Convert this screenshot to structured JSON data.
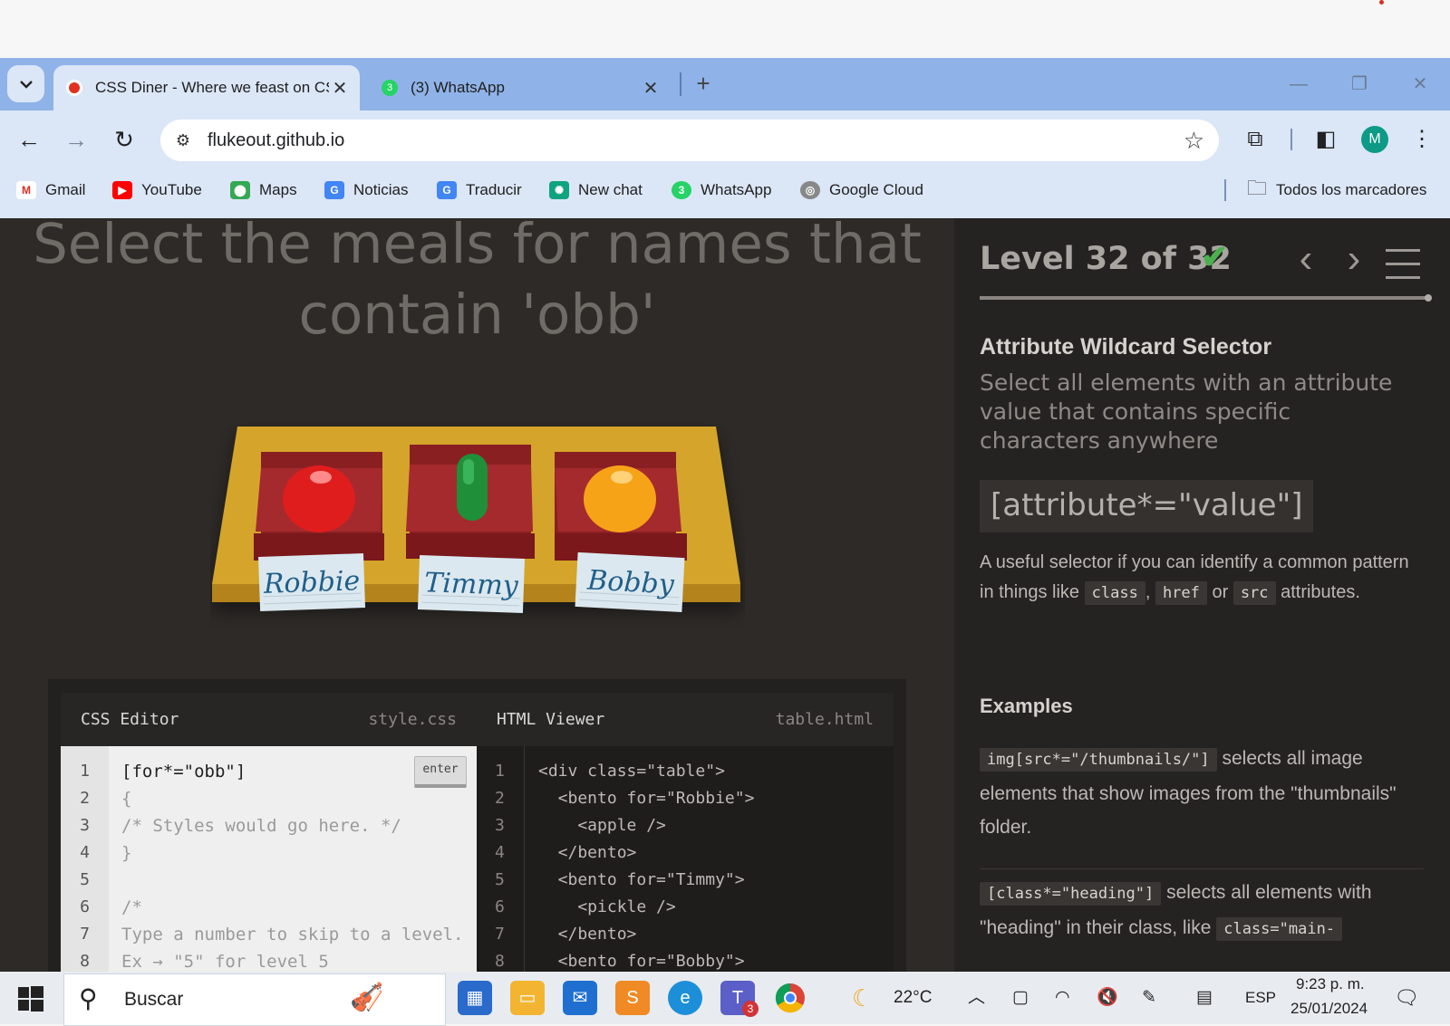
{
  "browser": {
    "tabs": [
      {
        "label": "CSS Diner - Where we feast on CSS Selectors!",
        "active": true
      },
      {
        "label": "(3) WhatsApp",
        "active": false
      }
    ],
    "url": "flukeout.github.io",
    "avatar_letter": "M",
    "bookmarks": [
      {
        "label": "Gmail",
        "icon": "gmail-icon"
      },
      {
        "label": "YouTube",
        "icon": "youtube-icon"
      },
      {
        "label": "Maps",
        "icon": "maps-icon"
      },
      {
        "label": "Noticias",
        "icon": "news-icon"
      },
      {
        "label": "Traducir",
        "icon": "translate-icon"
      },
      {
        "label": "New chat",
        "icon": "chatgpt-icon"
      },
      {
        "label": "WhatsApp",
        "icon": "whatsapp-icon"
      },
      {
        "label": "Google Cloud",
        "icon": "cloud-icon"
      }
    ],
    "all_bookmarks": "Todos los marcadores"
  },
  "game": {
    "instruction": "Select the meals for names that contain 'obb'",
    "bentos": [
      {
        "name": "Robbie",
        "food": "apple"
      },
      {
        "name": "Timmy",
        "food": "pickle"
      },
      {
        "name": "Bobby",
        "food": "orange"
      }
    ],
    "css_editor": {
      "title": "CSS Editor",
      "file": "style.css",
      "enter_label": "enter",
      "lines": [
        "[for*=\"obb\"]",
        "{",
        "/* Styles would go here. */",
        "}",
        "",
        "/*",
        "Type a number to skip to a level.",
        "Ex → \"5\" for level 5"
      ]
    },
    "html_viewer": {
      "title": "HTML Viewer",
      "file": "table.html",
      "lines": [
        "<div class=\"table\">",
        "  <bento for=\"Robbie\">",
        "    <apple />",
        "  </bento>",
        "  <bento for=\"Timmy\">",
        "    <pickle />",
        "  </bento>",
        "  <bento for=\"Bobby\">"
      ]
    },
    "level": {
      "text": "Level 32 of 32",
      "check": "✔",
      "current": 32,
      "total": 32,
      "progress": 1.0
    },
    "selector": {
      "name": "Attribute Wildcard Selector",
      "title": "Select all elements with an attribute value that contains specific characters anywhere",
      "syntax": "[attribute*=\"value\"]",
      "hint_prefix": "A useful selector if you can identify a common pattern in things like",
      "hint_code1": "class",
      "hint_sep1": ",",
      "hint_code2": "href",
      "hint_or": "or",
      "hint_code3": "src",
      "hint_suffix": "attributes.",
      "examples_heading": "Examples",
      "example1_code": "img[src*=\"/thumbnails/\"]",
      "example1_text": "selects all image elements that show images from the \"thumbnails\" folder.",
      "example2_code": "[class*=\"heading\"]",
      "example2_text": "selects all elements with \"heading\" in their class, like",
      "example2_code2": "class=\"main-"
    }
  },
  "taskbar": {
    "search_placeholder": "Buscar",
    "weather": "22°C",
    "language": "ESP",
    "time": "9:23 p. m.",
    "date": "25/01/2024",
    "teams_badge": "3"
  },
  "colors": {
    "tab_strip": "#8fb3e8",
    "toolbar": "#dbe6f7",
    "page_bg": "#2d2a27",
    "sidebar_bg": "#252222",
    "tray": "#d4a52b",
    "check": "#4caf50"
  }
}
